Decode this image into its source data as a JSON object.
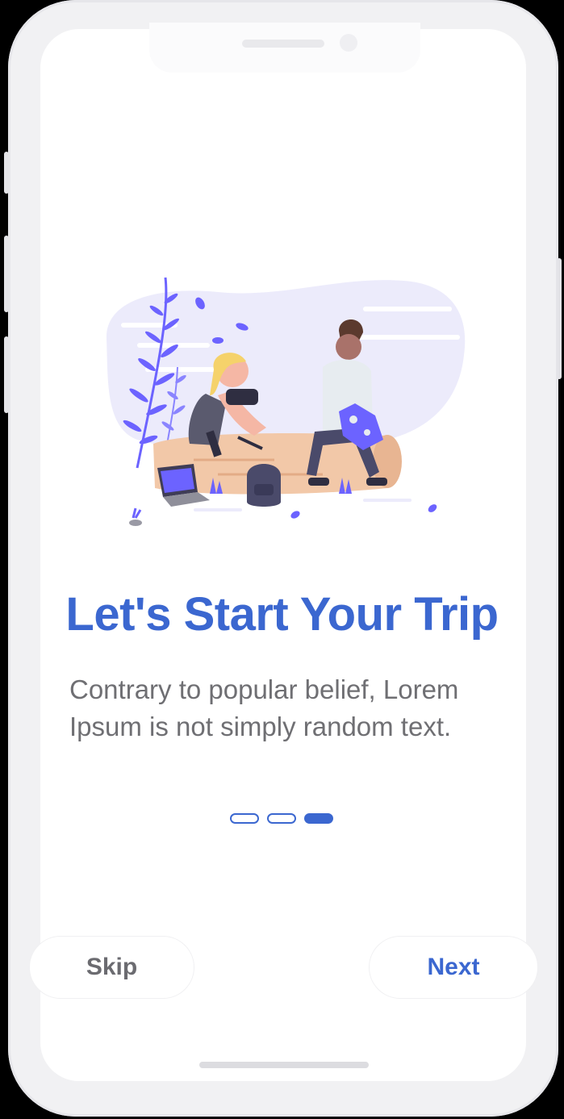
{
  "onboarding": {
    "title": "Let's Start Your Trip",
    "description": "Contrary to popular belief, Lorem Ipsum is not simply random text.",
    "pagination": {
      "total": 3,
      "current": 3
    }
  },
  "actions": {
    "skip_label": "Skip",
    "next_label": "Next"
  },
  "icons": {
    "illustration": "travelers-resting-illustration"
  },
  "colors": {
    "accent": "#3b67d0",
    "text_secondary": "#6f6f73",
    "illustration_accent": "#6c63ff"
  }
}
